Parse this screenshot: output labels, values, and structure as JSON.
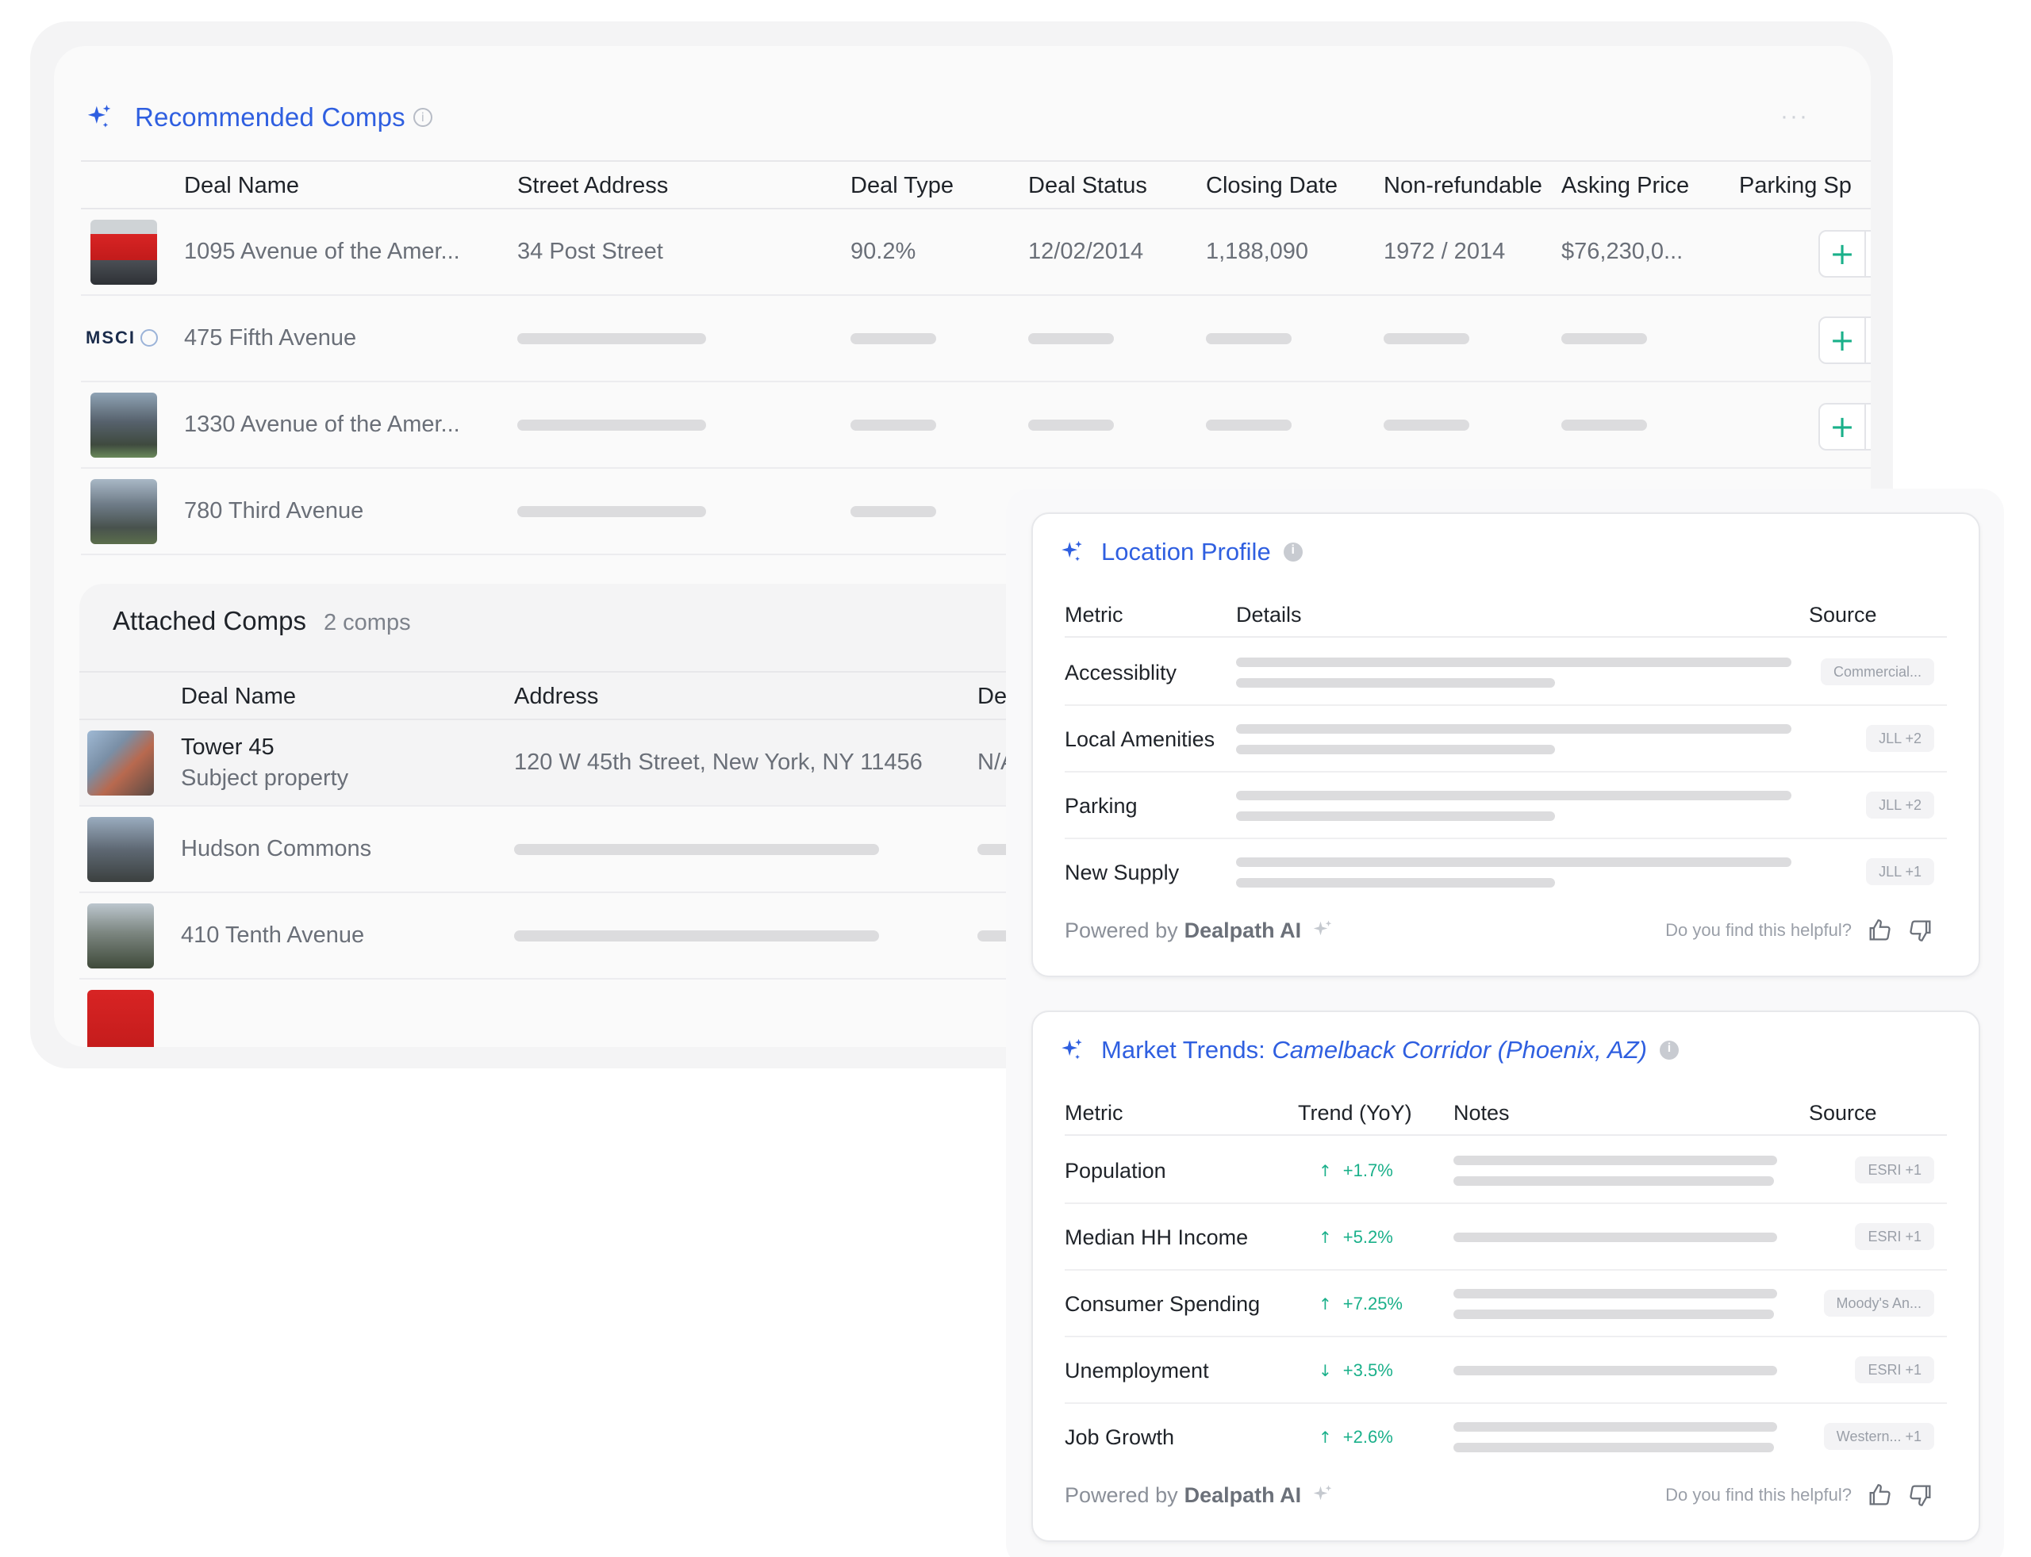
{
  "colors": {
    "accent": "#2f5fe0",
    "positive": "#1ab08a",
    "negative": "#e34b4b"
  },
  "recommended": {
    "title": "Recommended Comps",
    "columns": [
      "Deal Name",
      "Street Address",
      "Deal Type",
      "Deal Status",
      "Closing Date",
      "Non-refundable",
      "Asking Price",
      "Parking Sp"
    ],
    "rows": [
      {
        "name": "1095 Avenue of the Amer...",
        "address": "34 Post Street",
        "deal_type": "90.2%",
        "deal_status": "12/02/2014",
        "closing_date": "1,188,090",
        "non_refundable": "1972 / 2014",
        "asking_price": "$76,230,0..."
      },
      {
        "name": "475 Fifth Avenue",
        "logo": "MSCI"
      },
      {
        "name": "1330 Avenue of the Amer..."
      },
      {
        "name": "780 Third Avenue"
      }
    ],
    "add_label": "+",
    "remove_label": "−"
  },
  "attached": {
    "title": "Attached Comps",
    "count": "2 comps",
    "columns": [
      "Deal Name",
      "Address",
      "De"
    ],
    "rows": [
      {
        "name": "Tower 45",
        "subtitle": "Subject property",
        "address": "120 W 45th Street, New York, NY 11456",
        "extra": "N/A"
      },
      {
        "name": "Hudson Commons"
      },
      {
        "name": "410 Tenth Avenue"
      }
    ]
  },
  "location_profile": {
    "title": "Location Profile",
    "columns": [
      "Metric",
      "Details",
      "Source"
    ],
    "rows": [
      {
        "metric": "Accessiblity",
        "source": "Commercial..."
      },
      {
        "metric": "Local Amenities",
        "source": "JLL +2"
      },
      {
        "metric": "Parking",
        "source": "JLL +2"
      },
      {
        "metric": "New Supply",
        "source": "JLL +1"
      }
    ],
    "powered_prefix": "Powered by",
    "powered_brand": "Dealpath AI",
    "helpful": "Do you find this helpful?"
  },
  "market_trends": {
    "title_prefix": "Market Trends:",
    "title_location": "Camelback Corridor (Phoenix, AZ)",
    "columns": [
      "Metric",
      "Trend (YoY)",
      "Notes",
      "Source"
    ],
    "rows": [
      {
        "metric": "Population",
        "direction": "up",
        "trend": "+1.7%",
        "source": "ESRI +1"
      },
      {
        "metric": "Median HH Income",
        "direction": "up",
        "trend": "+5.2%",
        "source": "ESRI +1"
      },
      {
        "metric": "Consumer Spending",
        "direction": "up",
        "trend": "+7.25%",
        "source": "Moody's An..."
      },
      {
        "metric": "Unemployment",
        "direction": "down",
        "trend": "+3.5%",
        "source": "ESRI +1"
      },
      {
        "metric": "Job Growth",
        "direction": "up",
        "trend": "+2.6%",
        "source": "Western...  +1"
      }
    ],
    "powered_prefix": "Powered by",
    "powered_brand": "Dealpath AI",
    "helpful": "Do you find this helpful?"
  },
  "arrows": {
    "up": "↑",
    "down": "↓"
  }
}
